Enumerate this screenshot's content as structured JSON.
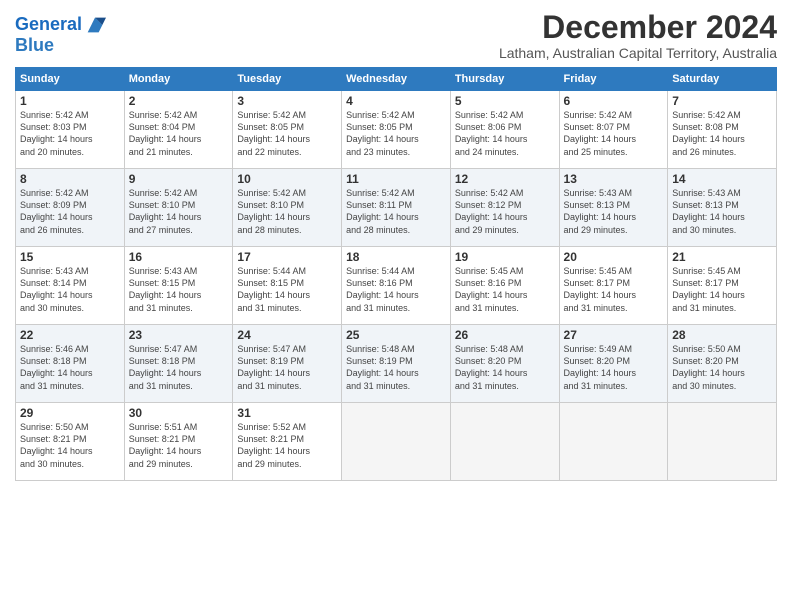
{
  "logo": {
    "line1": "General",
    "line2": "Blue"
  },
  "title": "December 2024",
  "subtitle": "Latham, Australian Capital Territory, Australia",
  "days_of_week": [
    "Sunday",
    "Monday",
    "Tuesday",
    "Wednesday",
    "Thursday",
    "Friday",
    "Saturday"
  ],
  "weeks": [
    [
      {
        "num": "1",
        "info": "Sunrise: 5:42 AM\nSunset: 8:03 PM\nDaylight: 14 hours\nand 20 minutes."
      },
      {
        "num": "2",
        "info": "Sunrise: 5:42 AM\nSunset: 8:04 PM\nDaylight: 14 hours\nand 21 minutes."
      },
      {
        "num": "3",
        "info": "Sunrise: 5:42 AM\nSunset: 8:05 PM\nDaylight: 14 hours\nand 22 minutes."
      },
      {
        "num": "4",
        "info": "Sunrise: 5:42 AM\nSunset: 8:05 PM\nDaylight: 14 hours\nand 23 minutes."
      },
      {
        "num": "5",
        "info": "Sunrise: 5:42 AM\nSunset: 8:06 PM\nDaylight: 14 hours\nand 24 minutes."
      },
      {
        "num": "6",
        "info": "Sunrise: 5:42 AM\nSunset: 8:07 PM\nDaylight: 14 hours\nand 25 minutes."
      },
      {
        "num": "7",
        "info": "Sunrise: 5:42 AM\nSunset: 8:08 PM\nDaylight: 14 hours\nand 26 minutes."
      }
    ],
    [
      {
        "num": "8",
        "info": "Sunrise: 5:42 AM\nSunset: 8:09 PM\nDaylight: 14 hours\nand 26 minutes."
      },
      {
        "num": "9",
        "info": "Sunrise: 5:42 AM\nSunset: 8:10 PM\nDaylight: 14 hours\nand 27 minutes."
      },
      {
        "num": "10",
        "info": "Sunrise: 5:42 AM\nSunset: 8:10 PM\nDaylight: 14 hours\nand 28 minutes."
      },
      {
        "num": "11",
        "info": "Sunrise: 5:42 AM\nSunset: 8:11 PM\nDaylight: 14 hours\nand 28 minutes."
      },
      {
        "num": "12",
        "info": "Sunrise: 5:42 AM\nSunset: 8:12 PM\nDaylight: 14 hours\nand 29 minutes."
      },
      {
        "num": "13",
        "info": "Sunrise: 5:43 AM\nSunset: 8:13 PM\nDaylight: 14 hours\nand 29 minutes."
      },
      {
        "num": "14",
        "info": "Sunrise: 5:43 AM\nSunset: 8:13 PM\nDaylight: 14 hours\nand 30 minutes."
      }
    ],
    [
      {
        "num": "15",
        "info": "Sunrise: 5:43 AM\nSunset: 8:14 PM\nDaylight: 14 hours\nand 30 minutes."
      },
      {
        "num": "16",
        "info": "Sunrise: 5:43 AM\nSunset: 8:15 PM\nDaylight: 14 hours\nand 31 minutes."
      },
      {
        "num": "17",
        "info": "Sunrise: 5:44 AM\nSunset: 8:15 PM\nDaylight: 14 hours\nand 31 minutes."
      },
      {
        "num": "18",
        "info": "Sunrise: 5:44 AM\nSunset: 8:16 PM\nDaylight: 14 hours\nand 31 minutes."
      },
      {
        "num": "19",
        "info": "Sunrise: 5:45 AM\nSunset: 8:16 PM\nDaylight: 14 hours\nand 31 minutes."
      },
      {
        "num": "20",
        "info": "Sunrise: 5:45 AM\nSunset: 8:17 PM\nDaylight: 14 hours\nand 31 minutes."
      },
      {
        "num": "21",
        "info": "Sunrise: 5:45 AM\nSunset: 8:17 PM\nDaylight: 14 hours\nand 31 minutes."
      }
    ],
    [
      {
        "num": "22",
        "info": "Sunrise: 5:46 AM\nSunset: 8:18 PM\nDaylight: 14 hours\nand 31 minutes."
      },
      {
        "num": "23",
        "info": "Sunrise: 5:47 AM\nSunset: 8:18 PM\nDaylight: 14 hours\nand 31 minutes."
      },
      {
        "num": "24",
        "info": "Sunrise: 5:47 AM\nSunset: 8:19 PM\nDaylight: 14 hours\nand 31 minutes."
      },
      {
        "num": "25",
        "info": "Sunrise: 5:48 AM\nSunset: 8:19 PM\nDaylight: 14 hours\nand 31 minutes."
      },
      {
        "num": "26",
        "info": "Sunrise: 5:48 AM\nSunset: 8:20 PM\nDaylight: 14 hours\nand 31 minutes."
      },
      {
        "num": "27",
        "info": "Sunrise: 5:49 AM\nSunset: 8:20 PM\nDaylight: 14 hours\nand 31 minutes."
      },
      {
        "num": "28",
        "info": "Sunrise: 5:50 AM\nSunset: 8:20 PM\nDaylight: 14 hours\nand 30 minutes."
      }
    ],
    [
      {
        "num": "29",
        "info": "Sunrise: 5:50 AM\nSunset: 8:21 PM\nDaylight: 14 hours\nand 30 minutes."
      },
      {
        "num": "30",
        "info": "Sunrise: 5:51 AM\nSunset: 8:21 PM\nDaylight: 14 hours\nand 29 minutes."
      },
      {
        "num": "31",
        "info": "Sunrise: 5:52 AM\nSunset: 8:21 PM\nDaylight: 14 hours\nand 29 minutes."
      },
      {
        "num": "",
        "info": ""
      },
      {
        "num": "",
        "info": ""
      },
      {
        "num": "",
        "info": ""
      },
      {
        "num": "",
        "info": ""
      }
    ]
  ]
}
